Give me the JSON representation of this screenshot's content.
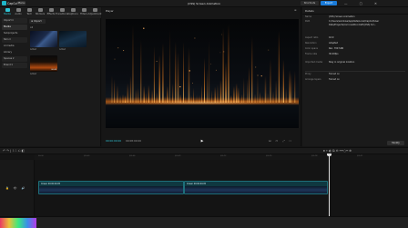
{
  "app": {
    "name": "CapCut",
    "menu_label": "Menu",
    "project_title": "(CSS) Screen Animation",
    "shortcuts_label": "Shortcuts",
    "export_label": "Export",
    "window_controls": "— ▢ ✕"
  },
  "media_tabs": [
    {
      "label": "Media",
      "active": true
    },
    {
      "label": "Audio",
      "active": false
    },
    {
      "label": "Text",
      "active": false
    },
    {
      "label": "Stickers",
      "active": false
    },
    {
      "label": "Effects",
      "active": false
    },
    {
      "label": "Transitions",
      "active": false
    },
    {
      "label": "Captions",
      "active": false
    },
    {
      "label": "Filters",
      "active": false
    },
    {
      "label": "Adjustment",
      "active": false
    }
  ],
  "sidebar": {
    "items": [
      {
        "label": "Import ▾",
        "selected": false,
        "dropdown": true
      },
      {
        "label": "Media",
        "selected": true,
        "dropdown": false
      },
      {
        "label": "Subprojects",
        "selected": false,
        "dropdown": false
      },
      {
        "label": "Skin ▾",
        "selected": false,
        "dropdown": true
      },
      {
        "label": "AI media",
        "selected": false,
        "dropdown": false
      },
      {
        "label": "Library",
        "selected": false,
        "dropdown": false
      },
      {
        "label": "Spaces ▾",
        "selected": false,
        "dropdown": true
      },
      {
        "label": "Brand ▾",
        "selected": false,
        "dropdown": true
      }
    ]
  },
  "media": {
    "import_label": "⊕ Import",
    "all_label": "All",
    "thumbnails": [
      {
        "caption": "Added",
        "mark": ""
      },
      {
        "caption": "Added",
        "mark": ""
      },
      {
        "caption": "Added",
        "mark": "00:08"
      }
    ]
  },
  "player": {
    "label": "Player",
    "menu_icon": "≡",
    "timecode": "00:00:00:00",
    "duration": "00:08:00:00",
    "play_icon": "▶",
    "right_controls": "⊡ ▭ ⤢ ⛶"
  },
  "details": {
    "label": "Details",
    "rows": [
      {
        "key": "Name",
        "value": "(CSS) Screen Animation"
      },
      {
        "key": "Path",
        "value": "C:/Users/windows/AppData/Local/CapCut/User Data/Projects/com.lveditor.draft/(CSS) Scr..."
      },
      {
        "key": "Aspect ratio",
        "value": "16:9"
      },
      {
        "key": "Resolution",
        "value": "Adapted"
      },
      {
        "key": "Color space",
        "value": "Rec. 709 SDR"
      },
      {
        "key": "Frame rate",
        "value": "30.00fps"
      },
      {
        "key": "Imported media",
        "value": "Stay in original location"
      },
      {
        "key": "Proxy",
        "value": "Turned on"
      },
      {
        "key": "Arrange layers",
        "value": "Turned on"
      }
    ],
    "modify_label": "Modify"
  },
  "timeline": {
    "ruler_ticks": [
      "00:00",
      "|00:03",
      "|00:06",
      "|00:09",
      "|00:12",
      "|00:15",
      "|00:18",
      "|00:21"
    ],
    "clips": [
      {
        "label": "Ocean  00:00:04:05"
      },
      {
        "label": "Ocean  00:00:04:05"
      }
    ],
    "toolbar_left": "↶ ↷ | ⌇ ⎍ ⎌ ◧",
    "toolbar_right": "⏺ ⌖ ◐ ⧉ ⊖ ━━○━ ⊕",
    "track_icons": "🔒 👁 🔊"
  },
  "taskbar": {
    "clock": ""
  }
}
